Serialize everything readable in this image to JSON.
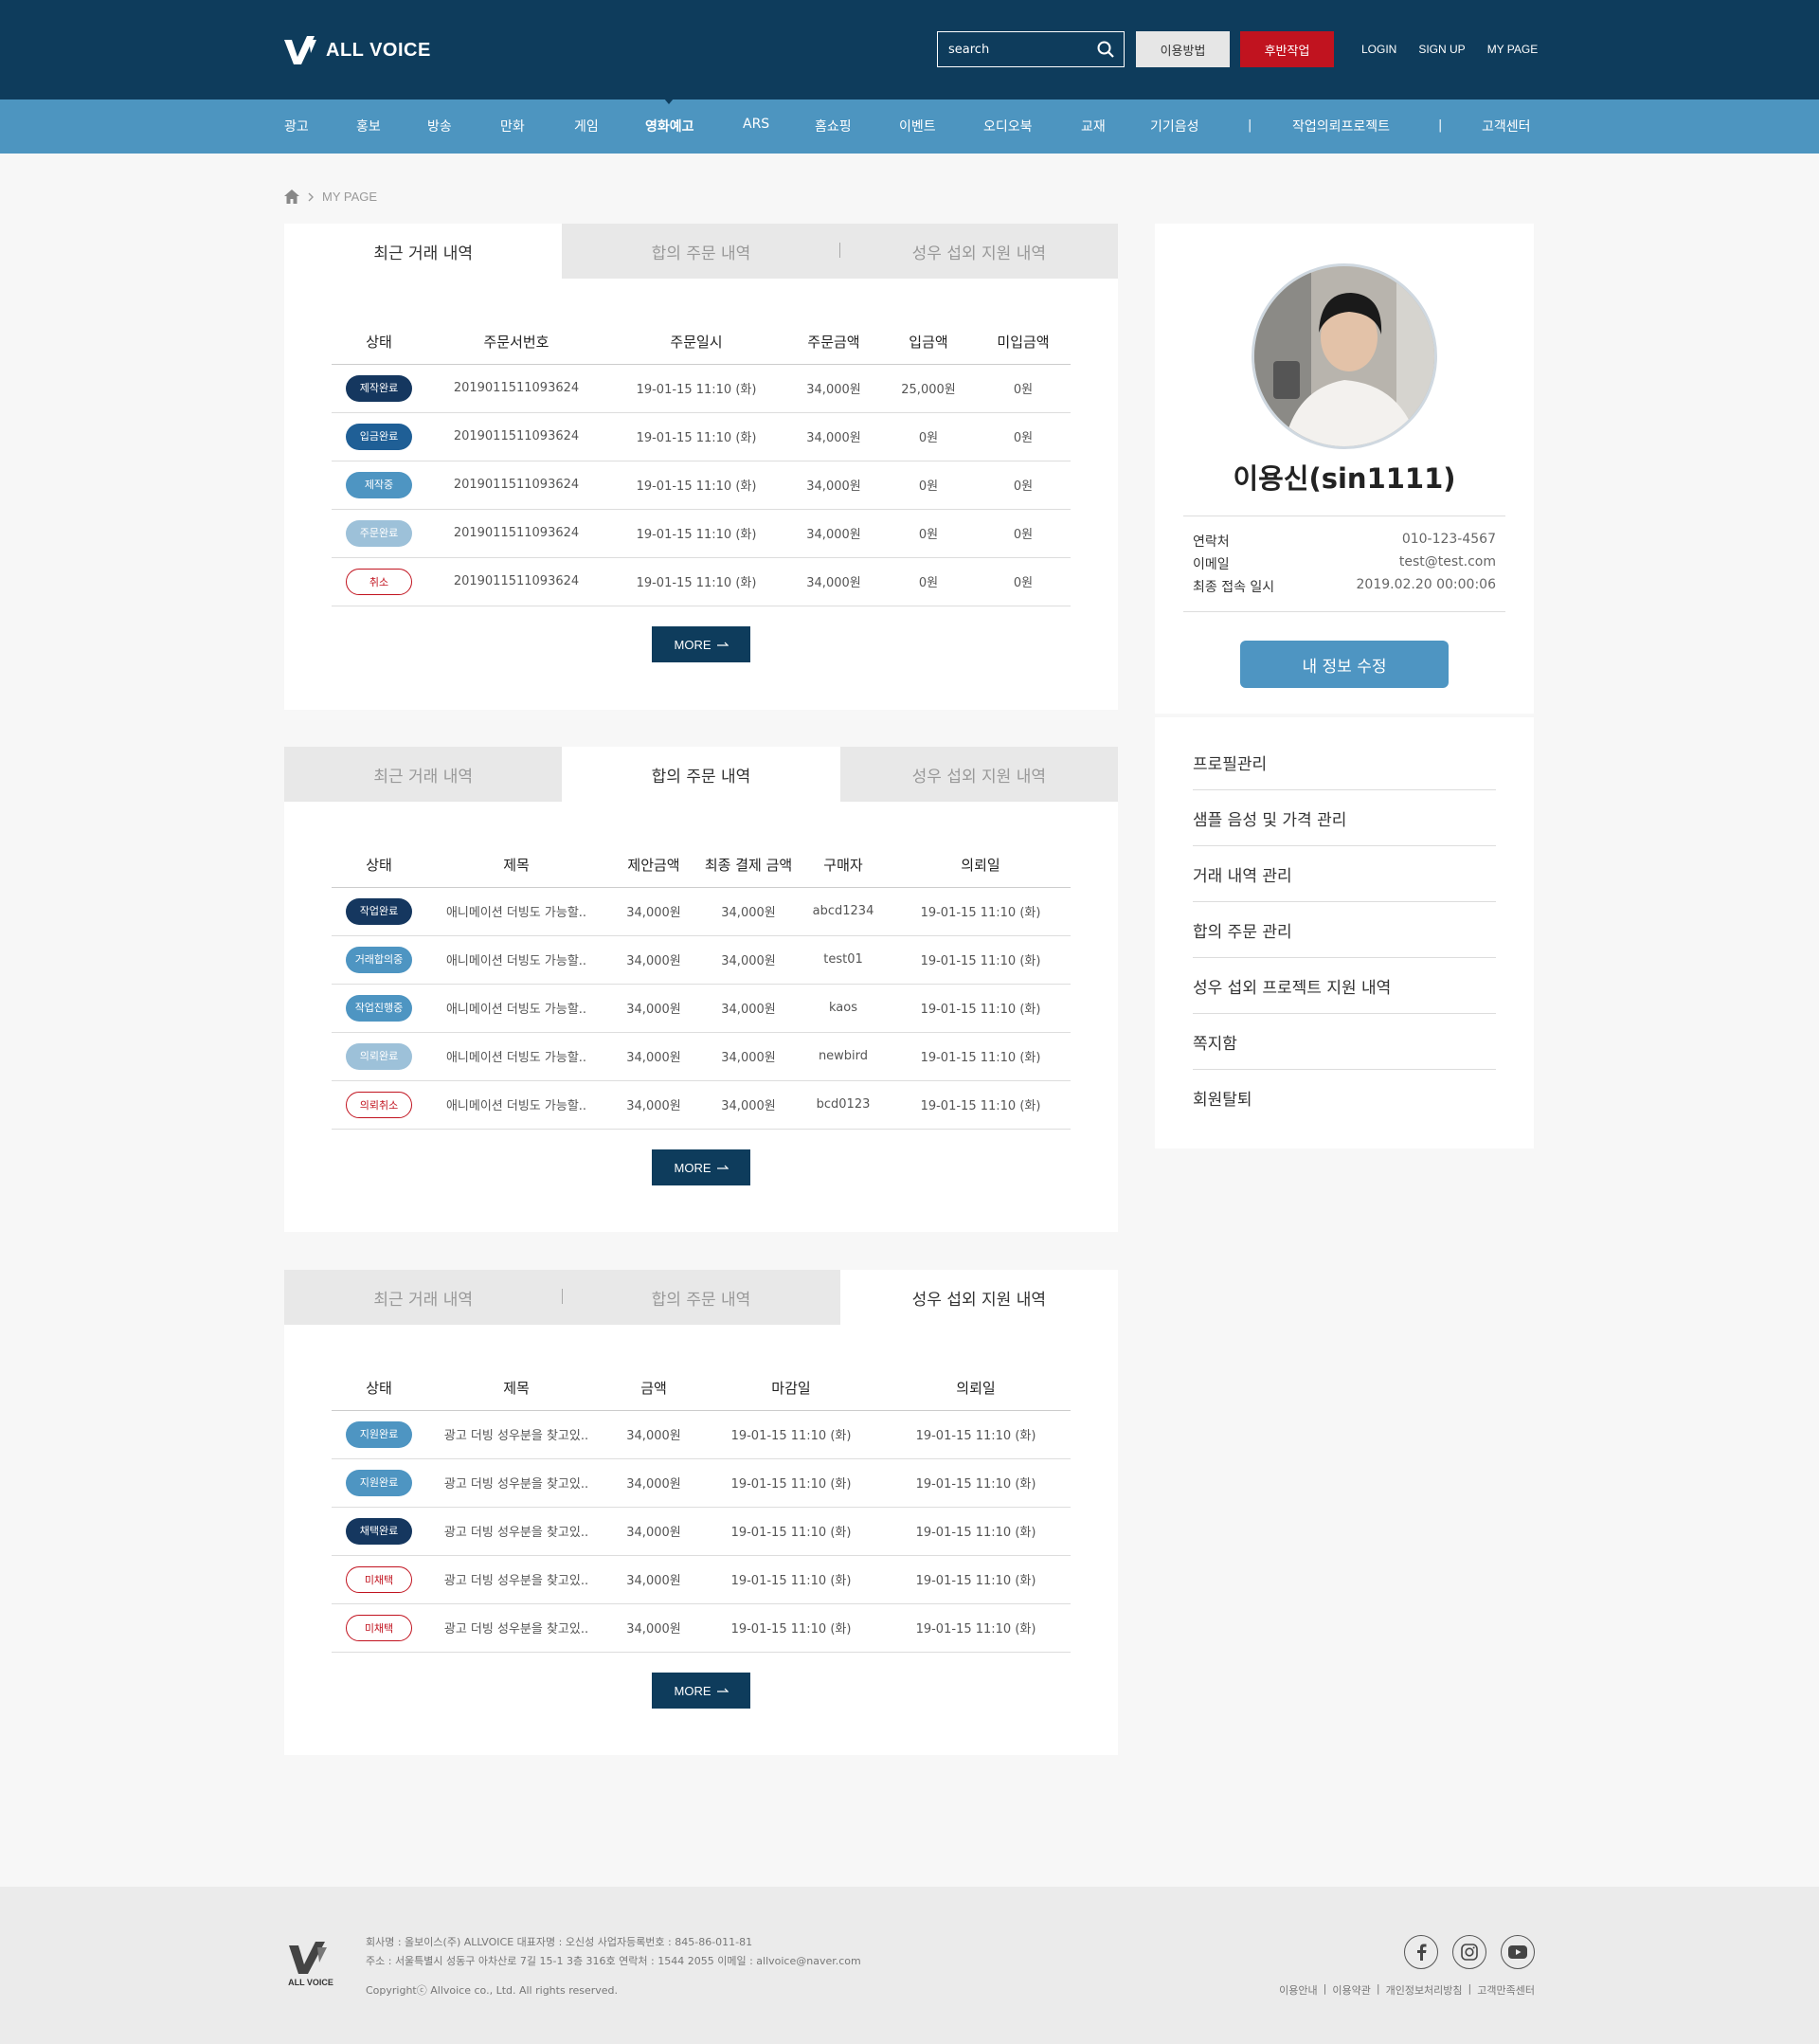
{
  "brand": {
    "name": "ALL VOICE",
    "footer_name": "ALL VOICE"
  },
  "header": {
    "search_placeholder": "search",
    "guide_button": "이용방법",
    "post_button": "후반작업",
    "links": [
      "LOGIN",
      "SIGN UP",
      "MY PAGE"
    ],
    "colors": {
      "header_bg": "#0e3c5c",
      "nav_bg": "#4d95c0",
      "post_button": "#c1131f"
    }
  },
  "nav": {
    "items": [
      "광고",
      "홍보",
      "방송",
      "만화",
      "게임",
      "영화예고",
      "ARS",
      "홈쇼핑",
      "이벤트",
      "오디오북",
      "교재",
      "기기음성",
      "작업의뢰프로젝트",
      "고객센터"
    ],
    "active": "영화예고",
    "separator": "|"
  },
  "breadcrumb": {
    "current": "MY PAGE"
  },
  "tabs": [
    "최근 거래 내역",
    "합의 주문 내역",
    "성우 섭외 지원 내역"
  ],
  "more_label": "MORE",
  "recent": {
    "headers": [
      "상태",
      "주문서번호",
      "주문일시",
      "주문금액",
      "입금액",
      "미입금액"
    ],
    "rows": [
      {
        "status": "제작완료",
        "order_no": "2019011511093624",
        "date": "19-01-15 11:10 (화)",
        "amount": "34,000원",
        "paid": "25,000원",
        "unpaid": "0원"
      },
      {
        "status": "입금완료",
        "order_no": "2019011511093624",
        "date": "19-01-15 11:10 (화)",
        "amount": "34,000원",
        "paid": "0원",
        "unpaid": "0원"
      },
      {
        "status": "제작중",
        "order_no": "2019011511093624",
        "date": "19-01-15 11:10 (화)",
        "amount": "34,000원",
        "paid": "0원",
        "unpaid": "0원"
      },
      {
        "status": "주문완료",
        "order_no": "2019011511093624",
        "date": "19-01-15 11:10 (화)",
        "amount": "34,000원",
        "paid": "0원",
        "unpaid": "0원"
      },
      {
        "status": "취소",
        "order_no": "2019011511093624",
        "date": "19-01-15 11:10 (화)",
        "amount": "34,000원",
        "paid": "0원",
        "unpaid": "0원"
      }
    ]
  },
  "agreed": {
    "headers": [
      "상태",
      "제목",
      "제안금액",
      "최종 결제 금액",
      "구매자",
      "의뢰일"
    ],
    "rows": [
      {
        "status": "작업완료",
        "title": "애니메이션 더빙도 가능할..",
        "offer": "34,000원",
        "final": "34,000원",
        "buyer": "abcd1234",
        "date": "19-01-15 11:10 (화)"
      },
      {
        "status": "거래합의중",
        "title": "애니메이션 더빙도 가능할..",
        "offer": "34,000원",
        "final": "34,000원",
        "buyer": "test01",
        "date": "19-01-15 11:10 (화)"
      },
      {
        "status": "작업진행중",
        "title": "애니메이션 더빙도 가능할..",
        "offer": "34,000원",
        "final": "34,000원",
        "buyer": "kaos",
        "date": "19-01-15 11:10 (화)"
      },
      {
        "status": "의뢰완료",
        "title": "애니메이션 더빙도 가능할..",
        "offer": "34,000원",
        "final": "34,000원",
        "buyer": "newbird",
        "date": "19-01-15 11:10 (화)"
      },
      {
        "status": "의뢰취소",
        "title": "애니메이션 더빙도 가능할..",
        "offer": "34,000원",
        "final": "34,000원",
        "buyer": "bcd0123",
        "date": "19-01-15 11:10 (화)"
      }
    ]
  },
  "casting": {
    "headers": [
      "상태",
      "제목",
      "금액",
      "마감일",
      "의뢰일"
    ],
    "rows": [
      {
        "status": "지원완료",
        "title": "광고 더빙 성우분을 찾고있..",
        "amount": "34,000원",
        "deadline": "19-01-15 11:10 (화)",
        "date": "19-01-15 11:10 (화)"
      },
      {
        "status": "지원완료",
        "title": "광고 더빙 성우분을 찾고있..",
        "amount": "34,000원",
        "deadline": "19-01-15 11:10 (화)",
        "date": "19-01-15 11:10 (화)"
      },
      {
        "status": "채택완료",
        "title": "광고 더빙 성우분을 찾고있..",
        "amount": "34,000원",
        "deadline": "19-01-15 11:10 (화)",
        "date": "19-01-15 11:10 (화)"
      },
      {
        "status": "미채택",
        "title": "광고 더빙 성우분을 찾고있..",
        "amount": "34,000원",
        "deadline": "19-01-15 11:10 (화)",
        "date": "19-01-15 11:10 (화)"
      },
      {
        "status": "미채택",
        "title": "광고 더빙 성우분을 찾고있..",
        "amount": "34,000원",
        "deadline": "19-01-15 11:10 (화)",
        "date": "19-01-15 11:10 (화)"
      }
    ]
  },
  "badge_colors": {
    "제작완료": "#15375f",
    "입금완료": "#1f5f96",
    "제작중": "#4e95c2",
    "주문완료": "#9dc1d9",
    "취소": "outline",
    "작업완료": "#15375f",
    "거래합의중": "#4e95c2",
    "작업진행중": "#4e95c2",
    "의뢰완료": "#9dc1d9",
    "의뢰취소": "outline",
    "지원완료": "#4e95c2",
    "채택완료": "#15375f",
    "미채택": "outline"
  },
  "profile": {
    "name": "이용신(sin1111)",
    "fields": [
      {
        "label": "연락처",
        "value": "010-123-4567"
      },
      {
        "label": "이메일",
        "value": "test@test.com"
      },
      {
        "label": "최종 접속 일시",
        "value": "2019.02.20 00:00:06"
      }
    ],
    "edit_button": "내 정보 수정"
  },
  "side_menu": [
    "프로필관리",
    "샘플 음성 및 가격 관리",
    "거래 내역 관리",
    "합의 주문 관리",
    "성우 섭외 프로젝트 지원 내역",
    "쪽지함",
    "회원탈퇴"
  ],
  "footer": {
    "line1": "회사명 : 올보이스(주) ALLVOICE  대표자명 : 오신성  사업자등록번호 : 845-86-011-81",
    "line2": "주소 : 서울특별시 성동구 아차산로 7길 15-1 3층 316호  연락처 : 1544 2055  이메일 : allvoice@naver.com",
    "copyright": "Copyrightⓒ Allvoice co., Ltd. All rights reserved.",
    "links": [
      "이용안내",
      "이용약관",
      "개인정보처리방침",
      "고객만족센터"
    ],
    "social_icons": [
      "facebook-icon",
      "instagram-icon",
      "youtube-icon"
    ]
  }
}
